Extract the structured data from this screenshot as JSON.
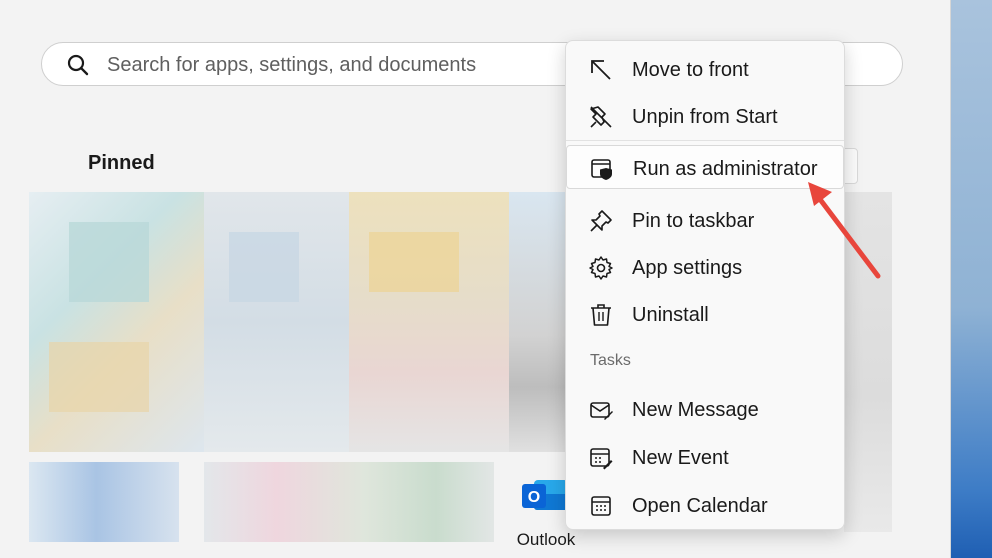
{
  "search": {
    "placeholder": "Search for apps, settings, and documents"
  },
  "pinned": {
    "title": "Pinned",
    "apps": [
      {
        "label": "Outlook",
        "icon": "outlook-icon"
      }
    ]
  },
  "context_menu": {
    "top_items": [
      {
        "label": "Move to front",
        "icon": "arrow-up-left-icon"
      },
      {
        "label": "Unpin from Start",
        "icon": "unpin-icon"
      }
    ],
    "highlighted_item": {
      "label": "Run as administrator",
      "icon": "shield-window-icon"
    },
    "items": [
      {
        "label": "Pin to taskbar",
        "icon": "pin-icon"
      },
      {
        "label": "App settings",
        "icon": "gear-icon"
      },
      {
        "label": "Uninstall",
        "icon": "trash-icon"
      }
    ],
    "tasks_header": "Tasks",
    "tasks": [
      {
        "label": "New Message",
        "icon": "new-message-icon"
      },
      {
        "label": "New Event",
        "icon": "new-event-icon"
      },
      {
        "label": "Open Calendar",
        "icon": "calendar-icon"
      }
    ]
  },
  "annotation": {
    "arrow_color": "#e8463c"
  },
  "colors": {
    "panel_bg": "#f3f3f3",
    "outlook_blue": "#0a64d6"
  }
}
